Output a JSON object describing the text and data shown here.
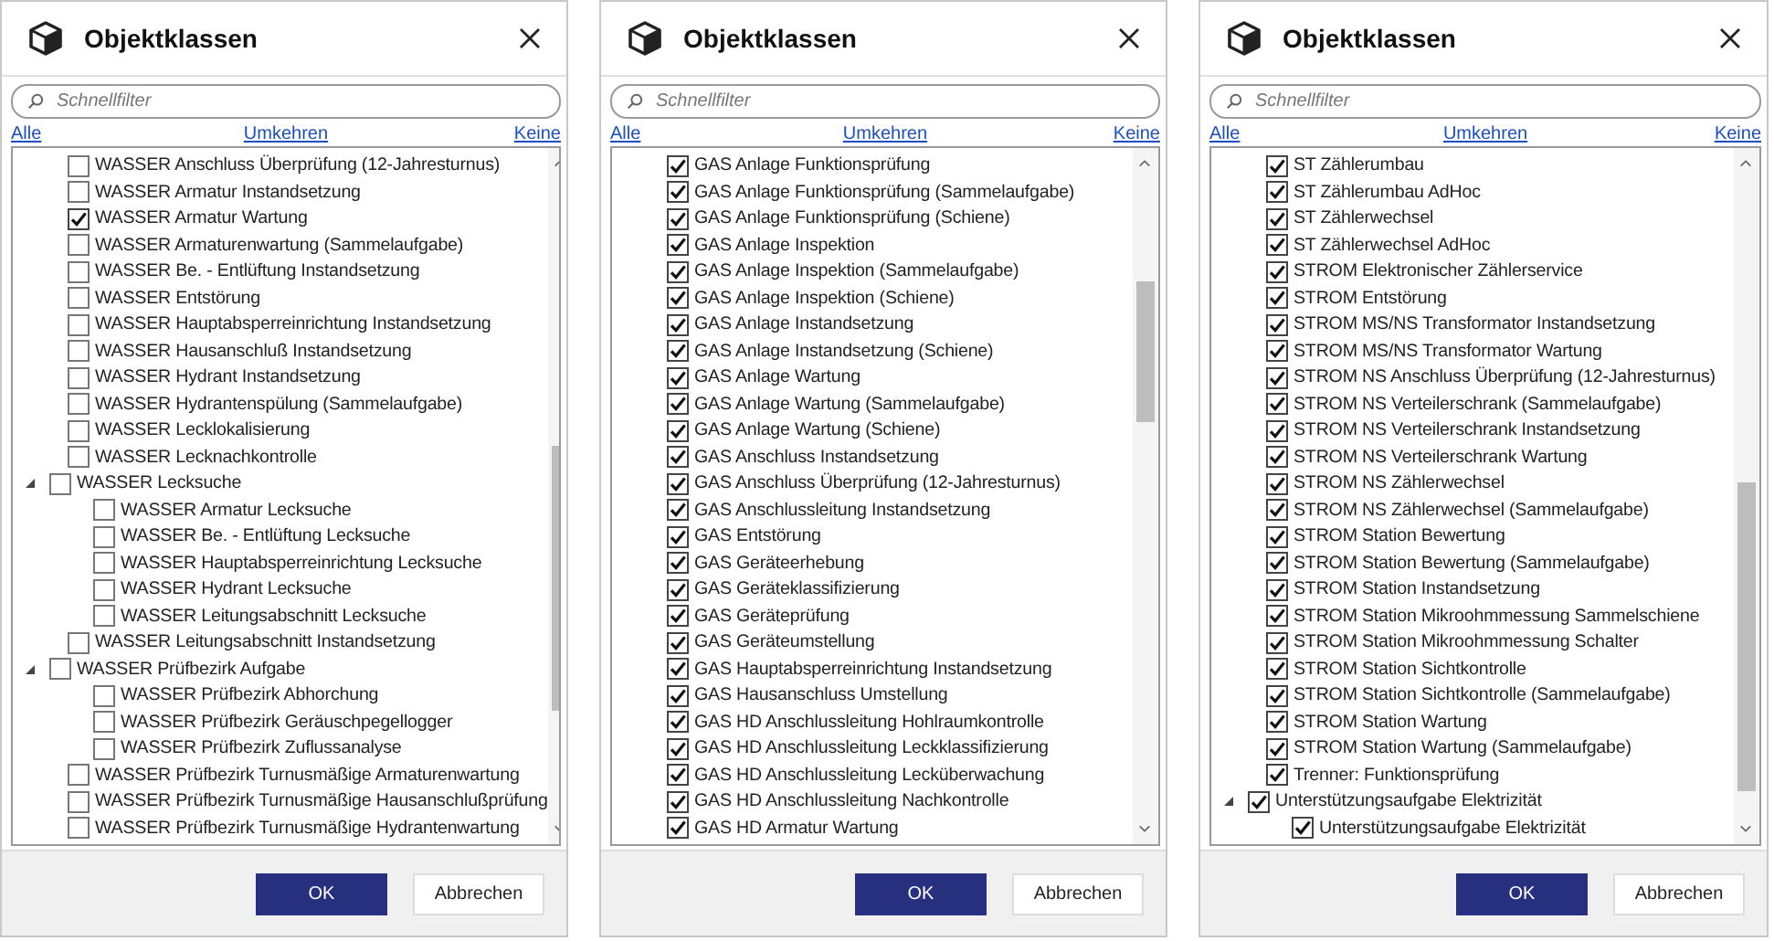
{
  "dialogs": [
    {
      "title": "Objektklassen",
      "filter": {
        "placeholder": "Schnellfilter"
      },
      "links": [
        "Alle",
        "Umkehren",
        "Keine"
      ],
      "items": [
        {
          "label": "WASSER Anschluss Überprüfung (12-Jahresturnus)",
          "checked": false
        },
        {
          "label": "WASSER Armatur Instandsetzung",
          "checked": false
        },
        {
          "label": "WASSER Armatur Wartung",
          "checked": true
        },
        {
          "label": "WASSER Armaturenwartung (Sammelaufgabe)",
          "checked": false
        },
        {
          "label": "WASSER Be. - Entlüftung Instandsetzung",
          "checked": false
        },
        {
          "label": "WASSER Entstörung",
          "checked": false
        },
        {
          "label": "WASSER Hauptabsperreinrichtung Instandsetzung",
          "checked": false
        },
        {
          "label": "WASSER Hausanschluß Instandsetzung",
          "checked": false
        },
        {
          "label": "WASSER Hydrant Instandsetzung",
          "checked": false
        },
        {
          "label": "WASSER Hydrantenspülung (Sammelaufgabe)",
          "checked": false
        },
        {
          "label": "WASSER Lecklokalisierung",
          "checked": false
        },
        {
          "label": "WASSER Lecknachkontrolle",
          "checked": false
        },
        {
          "label": "WASSER Lecksuche",
          "checked": false,
          "expanded": true,
          "children": [
            {
              "label": "WASSER Armatur Lecksuche",
              "checked": false
            },
            {
              "label": "WASSER Be. - Entlüftung Lecksuche",
              "checked": false
            },
            {
              "label": "WASSER Hauptabsperreinrichtung Lecksuche",
              "checked": false
            },
            {
              "label": "WASSER Hydrant Lecksuche",
              "checked": false
            },
            {
              "label": "WASSER Leitungsabschnitt Lecksuche",
              "checked": false
            }
          ]
        },
        {
          "label": "WASSER Leitungsabschnitt Instandsetzung",
          "checked": false
        },
        {
          "label": "WASSER Prüfbezirk Aufgabe",
          "checked": false,
          "expanded": true,
          "children": [
            {
              "label": "WASSER Prüfbezirk Abhorchung",
              "checked": false
            },
            {
              "label": "WASSER Prüfbezirk Geräuschpegellogger",
              "checked": false
            },
            {
              "label": "WASSER Prüfbezirk Zuflussanalyse",
              "checked": false
            }
          ]
        },
        {
          "label": "WASSER Prüfbezirk Turnusmäßige Armaturenwartung",
          "checked": false
        },
        {
          "label": "WASSER Prüfbezirk Turnusmäßige Hausanschlußprüfung",
          "checked": false
        },
        {
          "label": "WASSER Prüfbezirk Turnusmäßige Hydrantenwartung",
          "checked": false
        }
      ],
      "buttons": [
        {
          "label": "OK",
          "kind": "primary"
        },
        {
          "label": "Abbrechen",
          "kind": "secondary"
        }
      ]
    },
    {
      "title": "Objektklassen",
      "filter": {
        "placeholder": "Schnellfilter"
      },
      "links": [
        "Alle",
        "Umkehren",
        "Keine"
      ],
      "items": [
        {
          "label": "GAS Anlage Funktionsprüfung",
          "checked": true
        },
        {
          "label": "GAS Anlage Funktionsprüfung (Sammelaufgabe)",
          "checked": true
        },
        {
          "label": "GAS Anlage Funktionsprüfung (Schiene)",
          "checked": true
        },
        {
          "label": "GAS Anlage Inspektion",
          "checked": true
        },
        {
          "label": "GAS Anlage Inspektion (Sammelaufgabe)",
          "checked": true
        },
        {
          "label": "GAS Anlage Inspektion (Schiene)",
          "checked": true
        },
        {
          "label": "GAS Anlage Instandsetzung",
          "checked": true
        },
        {
          "label": "GAS Anlage Instandsetzung (Schiene)",
          "checked": true
        },
        {
          "label": "GAS Anlage Wartung",
          "checked": true
        },
        {
          "label": "GAS Anlage Wartung (Sammelaufgabe)",
          "checked": true
        },
        {
          "label": "GAS Anlage Wartung (Schiene)",
          "checked": true
        },
        {
          "label": "GAS Anschluss Instandsetzung",
          "checked": true
        },
        {
          "label": "GAS Anschluss Überprüfung (12-Jahresturnus)",
          "checked": true
        },
        {
          "label": "GAS Anschlussleitung Instandsetzung",
          "checked": true
        },
        {
          "label": "GAS Entstörung",
          "checked": true
        },
        {
          "label": "GAS Geräteerhebung",
          "checked": true
        },
        {
          "label": "GAS Geräteklassifizierung",
          "checked": true
        },
        {
          "label": "GAS Geräteprüfung",
          "checked": true
        },
        {
          "label": "GAS Geräteumstellung",
          "checked": true
        },
        {
          "label": "GAS Hauptabsperreinrichtung Instandsetzung",
          "checked": true
        },
        {
          "label": "GAS Hausanschluss Umstellung",
          "checked": true
        },
        {
          "label": "GAS HD Anschlussleitung Hohlraumkontrolle",
          "checked": true
        },
        {
          "label": "GAS HD Anschlussleitung Leckklassifizierung",
          "checked": true
        },
        {
          "label": "GAS HD Anschlussleitung Lecküberwachung",
          "checked": true
        },
        {
          "label": "GAS HD Anschlussleitung Nachkontrolle",
          "checked": true
        },
        {
          "label": "GAS HD Armatur Wartung",
          "checked": true
        }
      ],
      "buttons": [
        {
          "label": "OK",
          "kind": "primary"
        },
        {
          "label": "Abbrechen",
          "kind": "secondary"
        }
      ]
    },
    {
      "title": "Objektklassen",
      "filter": {
        "placeholder": "Schnellfilter"
      },
      "links": [
        "Alle",
        "Umkehren",
        "Keine"
      ],
      "items": [
        {
          "label": "ST Zählerumbau",
          "checked": true
        },
        {
          "label": "ST Zählerumbau AdHoc",
          "checked": true
        },
        {
          "label": "ST Zählerwechsel",
          "checked": true
        },
        {
          "label": "ST Zählerwechsel AdHoc",
          "checked": true
        },
        {
          "label": "STROM Elektronischer Zählerservice",
          "checked": true
        },
        {
          "label": "STROM Entstörung",
          "checked": true
        },
        {
          "label": "STROM MS/NS Transformator Instandsetzung",
          "checked": true
        },
        {
          "label": "STROM MS/NS Transformator Wartung",
          "checked": true
        },
        {
          "label": "STROM NS Anschluss Überprüfung (12-Jahresturnus)",
          "checked": true
        },
        {
          "label": "STROM NS Verteilerschrank (Sammelaufgabe)",
          "checked": true
        },
        {
          "label": "STROM NS Verteilerschrank Instandsetzung",
          "checked": true
        },
        {
          "label": "STROM NS Verteilerschrank Wartung",
          "checked": true
        },
        {
          "label": "STROM NS Zählerwechsel",
          "checked": true
        },
        {
          "label": "STROM NS Zählerwechsel (Sammelaufgabe)",
          "checked": true
        },
        {
          "label": "STROM Station Bewertung",
          "checked": true
        },
        {
          "label": "STROM Station Bewertung (Sammelaufgabe)",
          "checked": true
        },
        {
          "label": "STROM Station Instandsetzung",
          "checked": true
        },
        {
          "label": "STROM Station Mikroohmmessung Sammelschiene",
          "checked": true
        },
        {
          "label": "STROM Station Mikroohmmessung Schalter",
          "checked": true
        },
        {
          "label": "STROM Station Sichtkontrolle",
          "checked": true
        },
        {
          "label": "STROM Station Sichtkontrolle (Sammelaufgabe)",
          "checked": true
        },
        {
          "label": "STROM Station Wartung",
          "checked": true
        },
        {
          "label": "STROM Station Wartung (Sammelaufgabe)",
          "checked": true
        },
        {
          "label": "Trenner: Funktionsprüfung",
          "checked": true
        },
        {
          "label": "Unterstützungsaufgabe Elektrizität",
          "checked": true,
          "expanded": true,
          "children": [
            {
              "label": "Unterstützungsaufgabe Elektrizität",
              "checked": true
            }
          ]
        }
      ],
      "buttons": [
        {
          "label": "OK",
          "kind": "primary"
        },
        {
          "label": "Abbrechen",
          "kind": "secondary"
        }
      ]
    }
  ]
}
